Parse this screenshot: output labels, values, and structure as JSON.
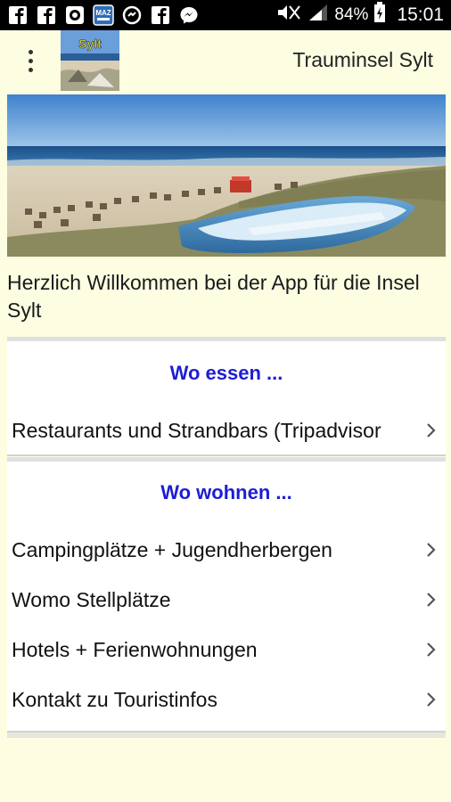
{
  "status_bar": {
    "notification_icons": [
      "facebook-icon",
      "facebook-icon",
      "chat-icon",
      "news-app-icon",
      "sync-icon",
      "facebook-icon",
      "messenger-icon"
    ],
    "battery": "84%",
    "time": "15:01"
  },
  "app_bar": {
    "logo_text": "Sylt",
    "title": "Trauminsel Sylt"
  },
  "welcome_text": "Herzlich Willkommen bei der App für die Insel Sylt",
  "sections": [
    {
      "heading": "Wo essen ...",
      "items": [
        {
          "label": "Restaurants und Strandbars (Tripadvisor"
        }
      ]
    },
    {
      "heading": "Wo wohnen ...",
      "items": [
        {
          "label": "Campingplätze + Jugendherbergen"
        },
        {
          "label": "Womo Stellplätze"
        },
        {
          "label": "Hotels + Ferienwohnungen"
        },
        {
          "label": "Kontakt zu Touristinfos"
        }
      ]
    }
  ],
  "colors": {
    "background": "#fdfde2",
    "heading": "#1d1dd4",
    "status_bar": "#000000"
  }
}
